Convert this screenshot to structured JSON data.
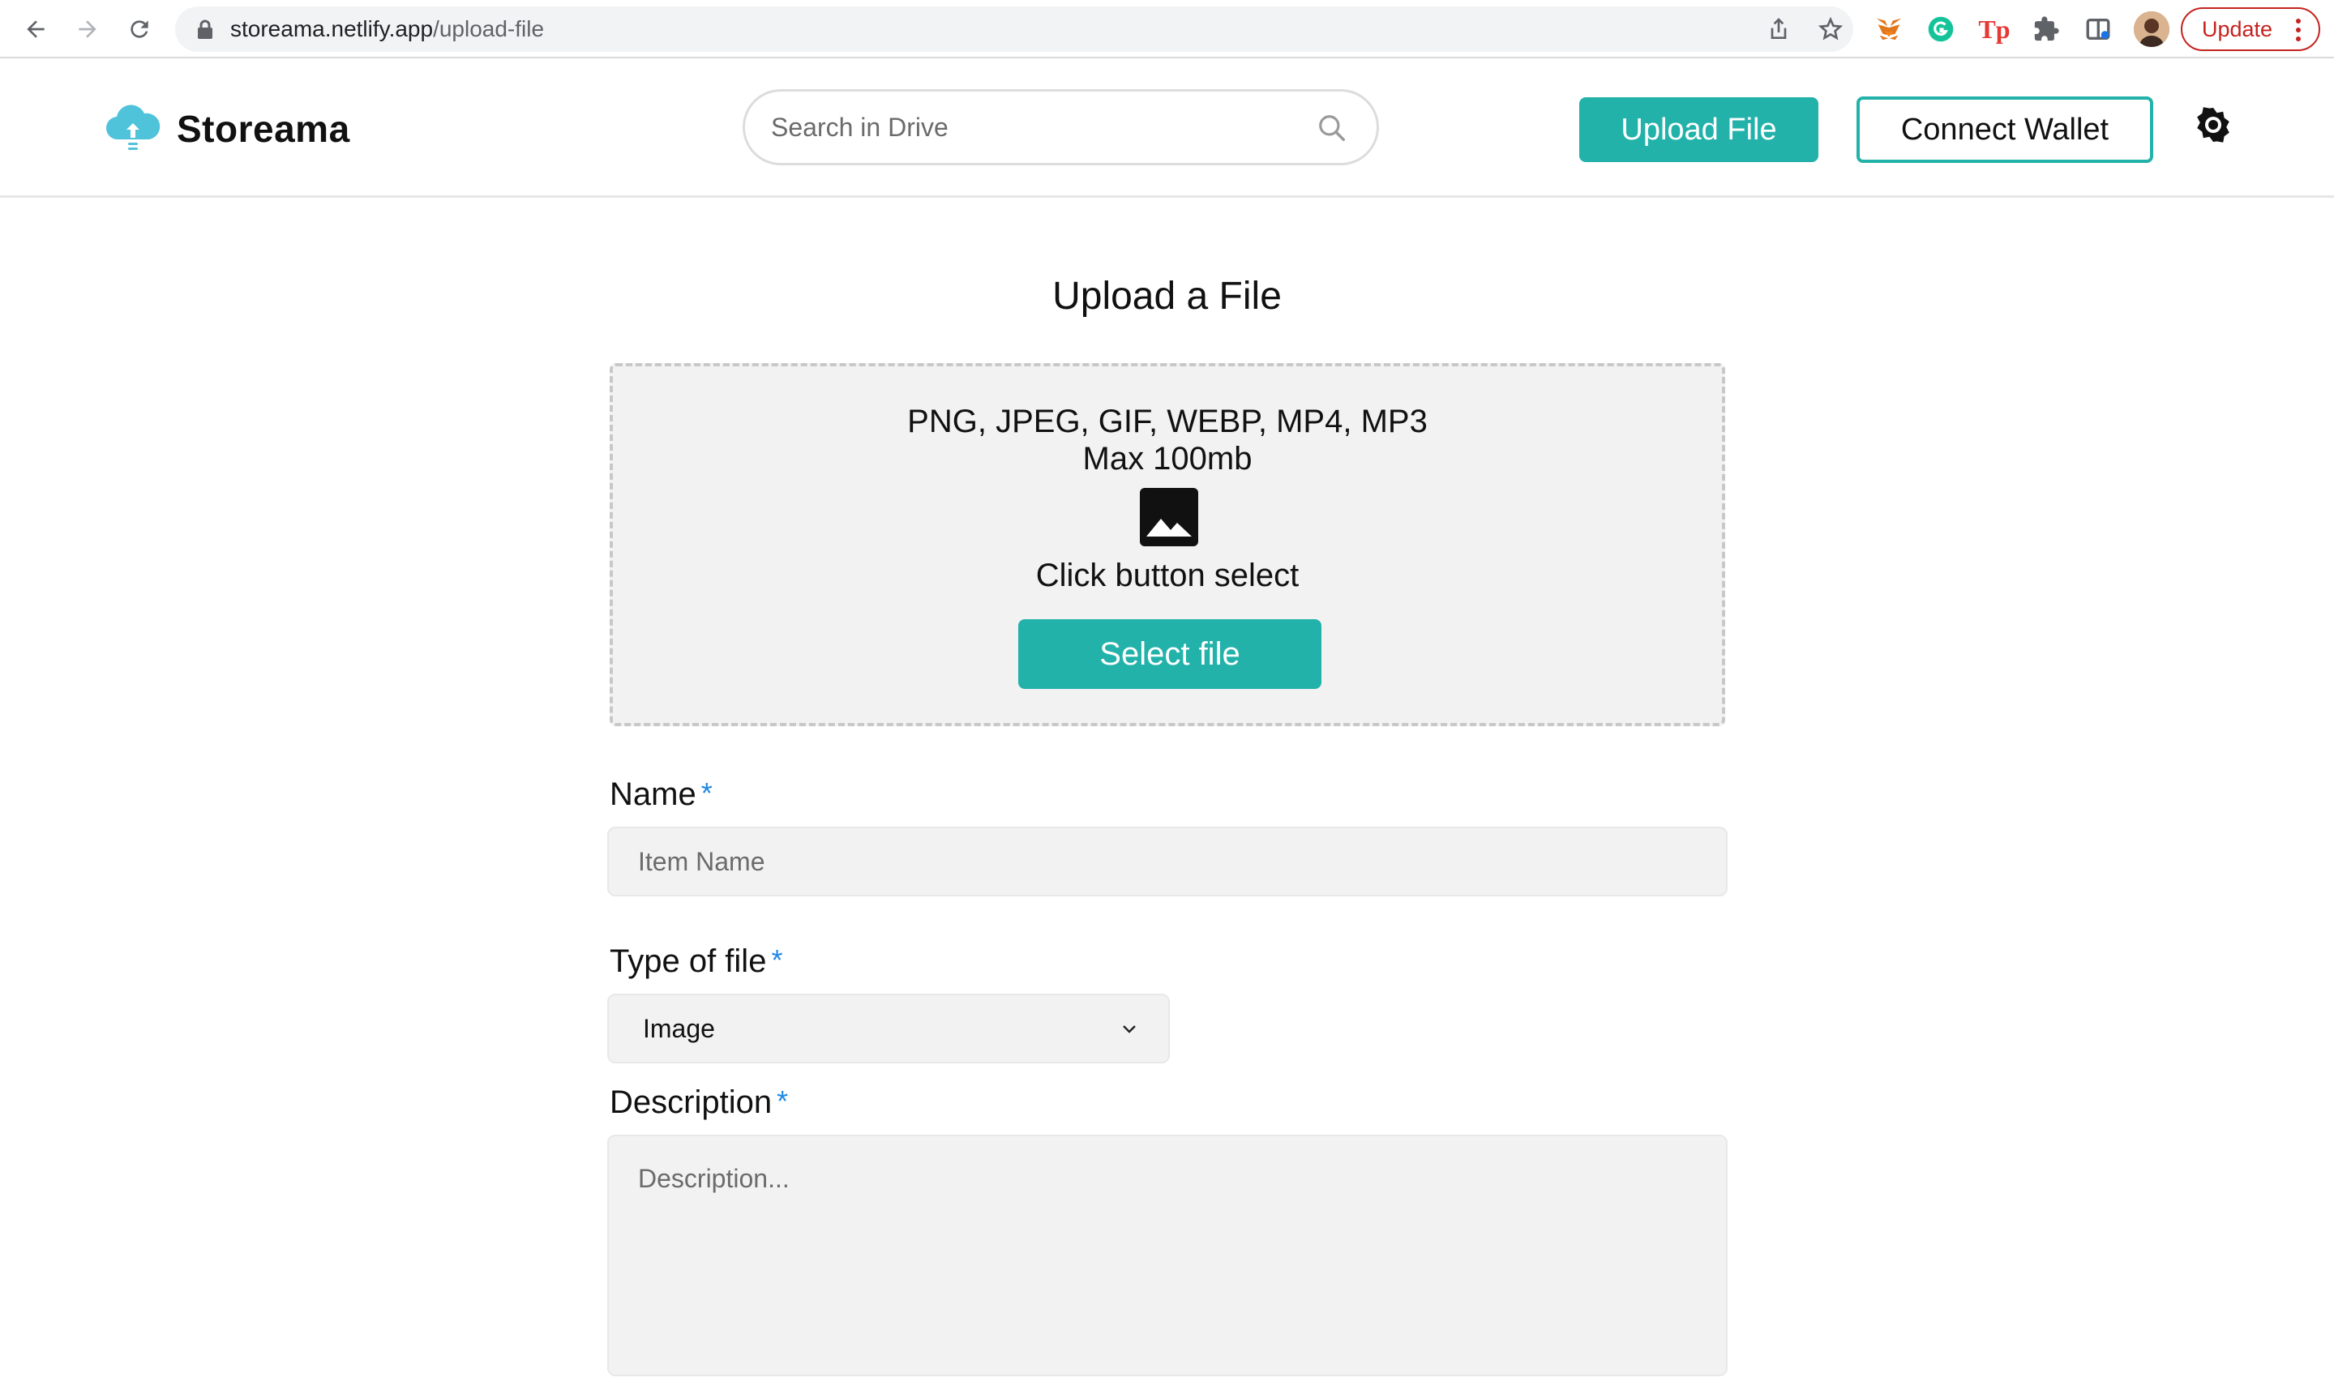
{
  "browser": {
    "url_host": "storeama.netlify.app",
    "url_path": "/upload-file",
    "update_label": "Update",
    "extensions": [
      "metamask-fox-icon",
      "grammarly-icon",
      "tp-extension-icon",
      "puzzle-icon",
      "reading-list-icon"
    ],
    "tp_label": "Tp"
  },
  "header": {
    "brand_name": "Storeama",
    "brand_color": "#22b2aa",
    "search_placeholder": "Search in Drive",
    "upload_button": "Upload File",
    "connect_button": "Connect Wallet"
  },
  "form": {
    "title": "Upload a File",
    "dropzone": {
      "formats": "PNG, JPEG, GIF, WEBP, MP4, MP3",
      "max_size": "Max 100mb",
      "hint": "Click button select",
      "select_button": "Select file"
    },
    "name": {
      "label": "Name",
      "required_mark": "*",
      "placeholder": "Item Name"
    },
    "type": {
      "label": "Type of file",
      "required_mark": "*",
      "selected": "Image"
    },
    "description": {
      "label": "Description",
      "required_mark": "*",
      "placeholder": "Description..."
    }
  }
}
